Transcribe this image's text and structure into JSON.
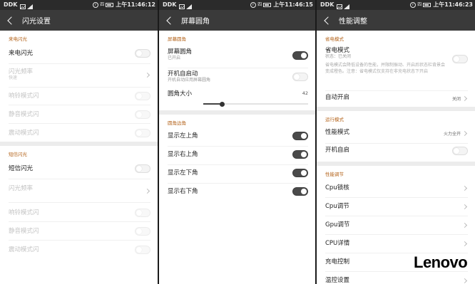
{
  "status": {
    "carrier": "DDK",
    "p1_time": "上午11:46:12",
    "p2_time": "上午11:46:15",
    "p3_time": "上午11:46:23",
    "badge": "四"
  },
  "panel1": {
    "title": "闪光设置",
    "section_call": "来电闪光",
    "call_flash": "来电闪光",
    "flash_freq": "闪光频率",
    "flash_freq_value": "快速",
    "ring_mode": "响铃模式闪",
    "silent_mode": "静音模式闪",
    "vibrate_mode": "震动模式闪",
    "section_sms": "短信闪光",
    "sms_flash": "短信闪光",
    "sms_freq": "闪光频率",
    "sms_ring_mode": "响铃模式闪",
    "sms_silent_mode": "静音模式闪",
    "sms_vibrate_mode": "震动模式闪"
  },
  "panel2": {
    "title": "屏幕圆角",
    "section_round": "屏幕圆角",
    "round_corner": "屏幕圆角",
    "round_corner_sub": "已开启",
    "boot_start": "开机自启动",
    "boot_start_sub": "开机自动应用屏幕圆角",
    "corner_size": "圆角大小",
    "corner_size_value": "42",
    "corner_size_fraction": 0.18,
    "section_corners": "圆角边角",
    "top_left": "显示左上角",
    "top_right": "显示右上角",
    "bottom_left": "显示左下角",
    "bottom_right": "显示右下角"
  },
  "panel3": {
    "title": "性能调整",
    "section_power": "省电模式",
    "power_save": "省电模式",
    "power_save_sub": "状态：已关闭",
    "power_save_desc": "省电模式会降低设备的性能，并限制振动、开启后状态栏背景会变成橙色。注意：省电模式仅支持在非充电状态下开启",
    "auto_start": "自动开启",
    "auto_start_value": "关闭",
    "section_run": "运行模式",
    "perf_mode": "性能模式",
    "perf_mode_value": "火力全开",
    "boot_start": "开机自启",
    "section_tune": "性能调节",
    "cpu_lock": "Cpu锁核",
    "cpu_adjust": "Cpu调节",
    "gpu_adjust": "Gpu调节",
    "cpu_detail": "CPU详情",
    "charge_ctrl": "充电控制",
    "temp_settings": "温控设置"
  },
  "watermark": "Lenovo"
}
